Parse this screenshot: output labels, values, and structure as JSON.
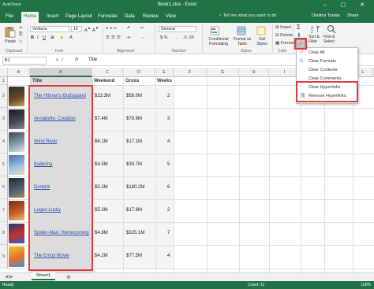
{
  "window": {
    "title": "Book1.xlsx  -  Excel",
    "quick_access": "AutoSave",
    "controls": "–  ▢  ✕"
  },
  "tabs": [
    "File",
    "Home",
    "Insert",
    "Page Layout",
    "Formulas",
    "Data",
    "Review",
    "View"
  ],
  "tell_me": "Tell me what you want to do",
  "user": "Dimitris Tonias",
  "share": "Share",
  "ribbon": {
    "paste": "Paste",
    "font_name": "Verdana",
    "font_size": "10",
    "number_format": "General",
    "conditional_formatting": "Conditional Formatting",
    "format_as_table": "Format as Table",
    "cell_styles": "Cell Styles",
    "insert": "Insert",
    "delete": "Delete",
    "format": "Format",
    "sort_filter": "Sort & Filter",
    "find_select": "Find & Select",
    "groups": [
      "Clipboard",
      "Font",
      "Alignment",
      "Number",
      "Styles",
      "Cells"
    ]
  },
  "formula_bar": {
    "name_box": "B1",
    "fx": "fx",
    "content": "Title"
  },
  "columns": [
    "A",
    "B",
    "C",
    "D",
    "E",
    "F",
    "G",
    "H",
    "I",
    "J",
    "K",
    "L"
  ],
  "rows": [
    "1",
    "2",
    "3",
    "4",
    "5",
    "6",
    "7",
    "8",
    "9"
  ],
  "table": {
    "headers": {
      "title": "Title",
      "weekend": "Weekend",
      "gross": "Gross",
      "weeks": "Weeks"
    },
    "rows": [
      {
        "title": "The Hitman's Bodyguard",
        "weekend": "$13.3M",
        "gross": "$58.0M",
        "weeks": "2"
      },
      {
        "title": "Annabelle: Creation",
        "weekend": "$7.4M",
        "gross": "$78.9M",
        "weeks": "3"
      },
      {
        "title": "Wind River",
        "weekend": "$6.1M",
        "gross": "$17.1M",
        "weeks": "4"
      },
      {
        "title": "Ballerina",
        "weekend": "$4.5M",
        "gross": "$39.7M",
        "weeks": "5"
      },
      {
        "title": "Dunkirk",
        "weekend": "$5.2M",
        "gross": "$180.2M",
        "weeks": "6"
      },
      {
        "title": "Logan Lucky",
        "weekend": "$5.3M",
        "gross": "$17.6M",
        "weeks": "2"
      },
      {
        "title": "Spider-Man: Homecoming",
        "weekend": "$4.8M",
        "gross": "$325.1M",
        "weeks": "7"
      },
      {
        "title": "The Emoji Movie",
        "weekend": "$4.2M",
        "gross": "$77.5M",
        "weeks": "4"
      }
    ]
  },
  "clear_menu": {
    "items": [
      "Clear All",
      "Clear Formats",
      "Clear Contents",
      "Clear Comments",
      "Clear Hyperlinks",
      "Remove Hyperlinks"
    ]
  },
  "sheet_tab": "Sheet1",
  "status": {
    "ready": "Ready",
    "count": "Count: 11",
    "zoom": "100%"
  },
  "colors": {
    "excel_green": "#217346",
    "highlight_red": "#e23b3b",
    "link_blue": "#2f4fb5"
  }
}
